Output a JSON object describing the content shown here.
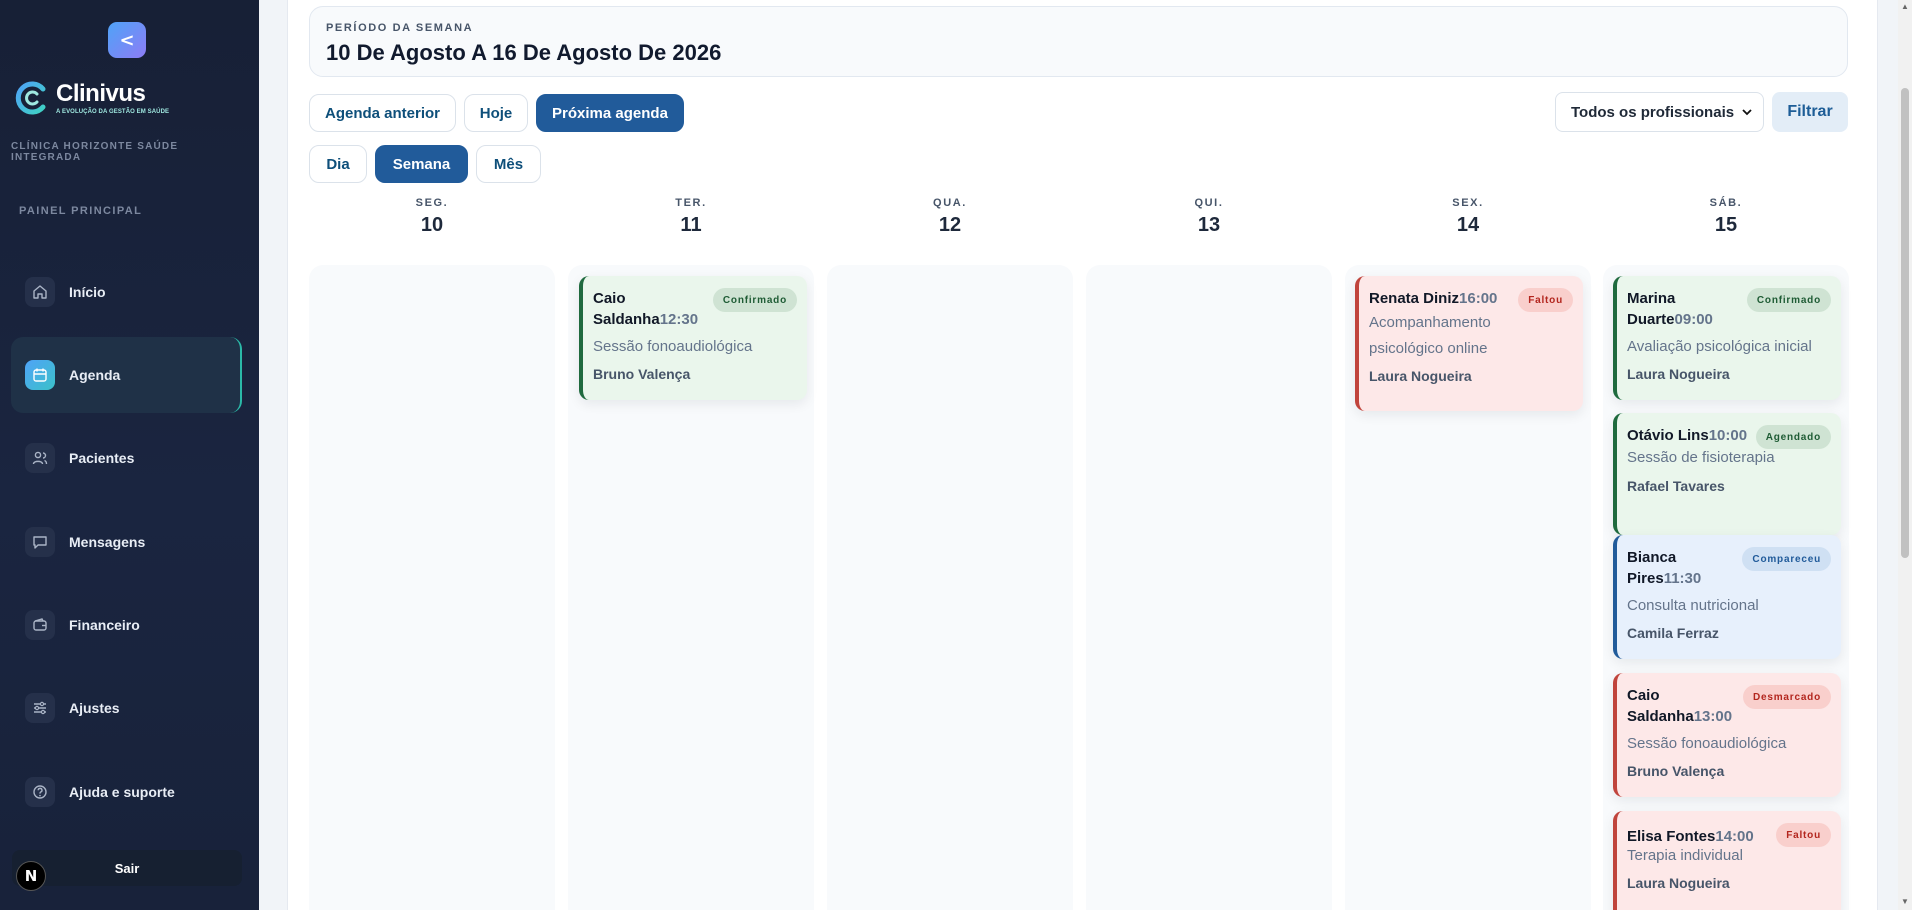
{
  "sidebar": {
    "collapse_glyph": "<",
    "logo_name": "Clinivus",
    "logo_tagline": "A EVOLUÇÃO DA GESTÃO EM SAÚDE",
    "clinic_name": "CLÍNICA HORIZONTE SAÚDE INTEGRADA",
    "panel_label": "PAINEL PRINCIPAL",
    "items": [
      {
        "label": "Início",
        "icon": "home-icon"
      },
      {
        "label": "Agenda",
        "icon": "calendar-icon",
        "active": true
      },
      {
        "label": "Pacientes",
        "icon": "users-icon"
      },
      {
        "label": "Mensagens",
        "icon": "message-icon"
      },
      {
        "label": "Financeiro",
        "icon": "wallet-icon"
      },
      {
        "label": "Ajustes",
        "icon": "sliders-icon"
      },
      {
        "label": "Ajuda e suporte",
        "icon": "help-icon"
      }
    ],
    "logout_label": "Sair",
    "badge_glyph": "N"
  },
  "period": {
    "label": "PERÍODO DA SEMANA",
    "value": "10 De Agosto A 16 De Agosto De 2026"
  },
  "nav_buttons": {
    "previous": "Agenda anterior",
    "today": "Hoje",
    "next": "Próxima agenda"
  },
  "view_tabs": {
    "day": "Dia",
    "week": "Semana",
    "month": "Mês",
    "active": "week"
  },
  "professional_filter": {
    "selected": "Todos os profissionais",
    "button": "Filtrar"
  },
  "days": [
    {
      "name": "SEG.",
      "number": "10"
    },
    {
      "name": "TER.",
      "number": "11"
    },
    {
      "name": "QUA.",
      "number": "12"
    },
    {
      "name": "QUI.",
      "number": "13"
    },
    {
      "name": "SEX.",
      "number": "14"
    },
    {
      "name": "SÁB.",
      "number": "15"
    }
  ],
  "appointments": {
    "tue_1": {
      "patient": "Caio Saldanha",
      "time": "12:30",
      "status": "Confirmado",
      "service": "Sessão fonoaudiológica",
      "professional": "Bruno Valença"
    },
    "fri_1": {
      "patient": "Renata Diniz",
      "time": "16:00",
      "status": "Faltou",
      "service": "Acompanhamento psicológico online",
      "professional": "Laura Nogueira"
    },
    "sat_1": {
      "patient": "Marina Duarte",
      "time": "09:00",
      "status": "Confirmado",
      "service": "Avaliação psicológica inicial",
      "professional": "Laura Nogueira"
    },
    "sat_2": {
      "patient": "Otávio Lins",
      "time": "10:00",
      "status": "Agendado",
      "service": "Sessão de fisioterapia",
      "professional": "Rafael Tavares"
    },
    "sat_3": {
      "patient": "Bianca Pires",
      "time": "11:30",
      "status": "Compareceu",
      "service": "Consulta nutricional",
      "professional": "Camila Ferraz"
    },
    "sat_4": {
      "patient": "Caio Saldanha",
      "time": "13:00",
      "status": "Desmarcado",
      "service": "Sessão fonoaudiológica",
      "professional": "Bruno Valença"
    },
    "sat_5": {
      "patient": "Elisa Fontes",
      "time": "14:00",
      "status": "Faltou",
      "service": "Terapia individual",
      "professional": "Laura Nogueira"
    }
  },
  "colors": {
    "primary": "#215b9a",
    "sidebar_bg": "#172036",
    "confirmed": "#1f6a3e",
    "missed": "#c0443c",
    "attended": "#215b9a"
  }
}
